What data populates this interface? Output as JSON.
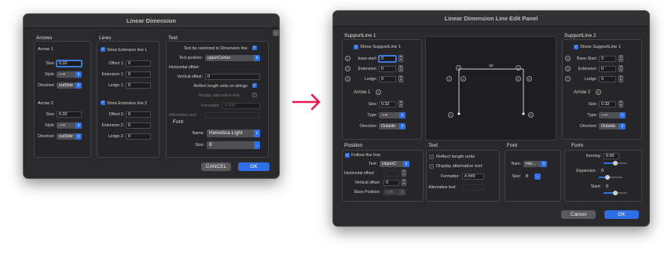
{
  "left_window": {
    "title": "Linear Dimension",
    "arrows": {
      "heading": "Arrows",
      "arrow1": {
        "heading": "Arrow 1",
        "size_label": "Size:",
        "size": "0.32",
        "style_label": "Style:",
        "style": "⟶",
        "direction_label": "Direction:",
        "direction": "outSide"
      },
      "arrow2": {
        "heading": "Arrow 2",
        "size_label": "Size:",
        "size": "0.32",
        "style_label": "Style:",
        "style": "⟶",
        "direction_label": "Direction:",
        "direction": "outSide"
      }
    },
    "lines": {
      "heading": "Lines",
      "ext1": {
        "check": "Show Extension line 1",
        "offset_label": "Offset 1:",
        "offset": "0",
        "extension_label": "Extension 1:",
        "extension": "0",
        "ledge_label": "Ledge 1:",
        "ledge": "0"
      },
      "ext2": {
        "check": "Show Extension line 2",
        "offset_label": "Offset 2:",
        "offset": "0",
        "extension_label": "Extension 2:",
        "extension": "0",
        "ledge_label": "Ledge 2:",
        "ledge": "0"
      }
    },
    "text": {
      "heading": "Text",
      "restricted": "Text be restricted to Dimension line:",
      "position_label": "Text position:",
      "position": "upperCenter",
      "hoffset_label": "Horizontal offset:",
      "hoffset": "",
      "voffset_label": "Vertical offset:",
      "voffset": "0",
      "reflect": "Reflect length units on strings:",
      "display_alt": "Display alternative text:",
      "formatter_label": "Formatter:",
      "formatter": "#,##0",
      "alt_text_label": "Alternative text:",
      "font_heading": "Font",
      "name_label": "Name:",
      "font_name": "Helvetica Light",
      "size_label": "Size:",
      "font_size": "8"
    },
    "cancel": "CANCEL",
    "ok": "OK"
  },
  "right_window": {
    "title": "Linear Dimension Line Edit Panel",
    "support1": {
      "heading": "SupportLine 1",
      "check": "Show SupportLine 1",
      "base_label": "base-start:",
      "base": "0",
      "extension_label": "Extension:",
      "extension": "0",
      "ledge_label": "Ledge:",
      "ledge": "0",
      "arrow_heading": "Arrow 1",
      "size_label": "Size:",
      "size": "0.32",
      "type_label": "Type:",
      "type": "⟶",
      "direction_label": "Direction:",
      "direction": "Outside"
    },
    "support2": {
      "heading": "SupportLine  2",
      "check": "Show SupportLine 1",
      "base_label": "Base-Start:",
      "base": "0",
      "extension_label": "Extension:",
      "extension": "0",
      "ledge_label": "Ledge:",
      "ledge": "0",
      "arrow_heading": "Arrow 2",
      "size_label": "Size:",
      "size": "0.32",
      "type_label": "Type:",
      "type": "⟶",
      "direction_label": "Direction:",
      "direction": "Outside"
    },
    "preview": {
      "dimension_value": "60",
      "markers": [
        "1",
        "2",
        "3",
        "4",
        "5",
        "6",
        "7",
        "8"
      ]
    },
    "left_markers": [
      "1",
      "2",
      "3"
    ],
    "right_markers": [
      "8",
      "9",
      "7"
    ],
    "arrow1_marker": "4",
    "arrow2_marker": "6",
    "position": {
      "heading": "Position",
      "follow": "Follow the line",
      "text_label": "Text:",
      "text": "UpperC",
      "hoffset_label": "Horizontal offset:",
      "hoffset": "",
      "voffset_label": "Vertical offset:",
      "voffset": "0",
      "base_label": "Base Position:",
      "base": "Left..."
    },
    "text": {
      "heading": "Text",
      "reflect": "Reflect length units",
      "display_alt": "Display alternative text",
      "formatter_label": "Formatter:",
      "formatter": "#,##0",
      "alt_label": "Alternative text:"
    },
    "font": {
      "heading": "Font",
      "name_label": "Nam:",
      "name": "Hel...",
      "size_label": "Size:",
      "size": "8"
    },
    "form": {
      "heading": "Form",
      "kerning_label": "Kerning:",
      "kerning": "0.50",
      "kerning_level": 0.5,
      "expansion_label": "Expansion:",
      "expansion": "0",
      "expansion_level": 0.35,
      "slant_label": "Slant:",
      "slant": "0",
      "slant_level": 0.5
    },
    "cancel": "Cancel",
    "ok": "OK"
  },
  "colors": {
    "accent": "#2f6fe5",
    "arrow": "#e8194f"
  }
}
